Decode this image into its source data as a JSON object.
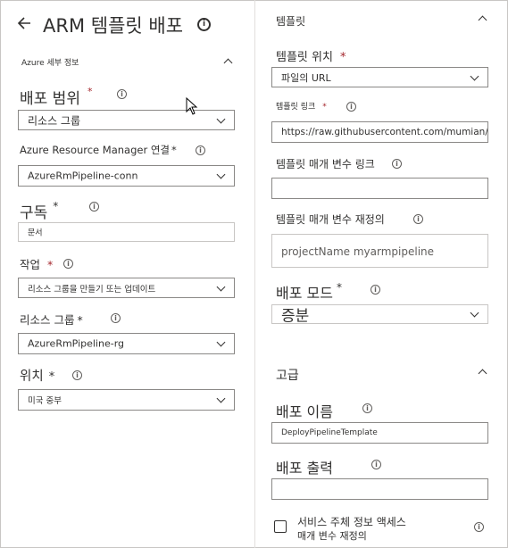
{
  "header": {
    "title": "ARM 템플릿 배포"
  },
  "azure_details": {
    "section_title": "Azure 세부 정보",
    "scope_label": "배포 범위",
    "scope_value": "리소스 그룹",
    "connection_label": "Azure Resource Manager 연결",
    "connection_value": "AzureRmPipeline-conn",
    "subscription_label": "구독",
    "subscription_value": "문서",
    "action_label": "작업",
    "action_value": "리소스 그룹을 만들기 또는 업데이트",
    "resource_group_label": "리소스 그룹",
    "resource_group_value": "AzureRmPipeline-rg",
    "location_label": "위치",
    "location_value": "미국 중부",
    "required_mark": "*"
  },
  "template": {
    "section_title": "템플릿",
    "location_label": "템플릿 위치",
    "location_value": "파일의 URL",
    "link_label": "템플릿 링크",
    "link_value": "https://raw.githubusercontent.com/mumian/a",
    "params_link_label": "템플릿 매개 변수 링크",
    "params_link_value": "",
    "override_label": "템플릿 매개 변수 재정의",
    "override_value": "projectName myarmpipeline",
    "mode_label": "배포 모드",
    "mode_value": "증분"
  },
  "advanced": {
    "section_title": "고급",
    "deployment_name_label": "배포 이름",
    "deployment_name_value": "DeployPipelineTemplate",
    "outputs_label": "배포 출력",
    "outputs_value": "",
    "checkbox_label_line1": "서비스 주체 정보 액세스",
    "checkbox_label_line2": "매개 변수 재정의",
    "checkbox_checked": false
  }
}
